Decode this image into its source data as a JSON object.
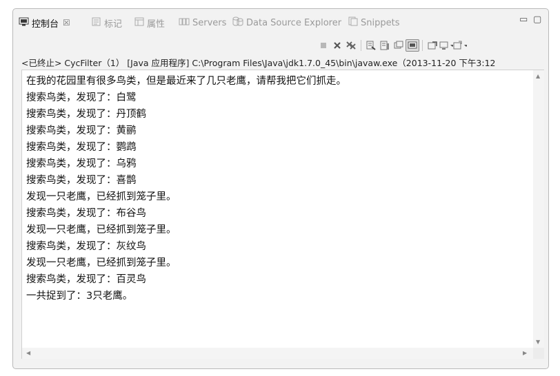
{
  "tabs": [
    {
      "label": "控制台",
      "icon": "console-icon",
      "active": true
    },
    {
      "label": "标记",
      "icon": "markers-icon"
    },
    {
      "label": "属性",
      "icon": "properties-icon"
    },
    {
      "label": "Servers",
      "icon": "servers-icon"
    },
    {
      "label": "Data Source Explorer",
      "icon": "database-icon"
    },
    {
      "label": "Snippets",
      "icon": "snippets-icon"
    }
  ],
  "active_tab_close": "☒",
  "window_controls": {
    "minimize": "▭",
    "maximize": "▢"
  },
  "toolbar_icons": [
    "stop-icon",
    "remove-launch-icon",
    "remove-all-icon",
    "clear-console-icon",
    "scroll-lock-icon",
    "word-wrap-icon",
    "pin-console-icon",
    "display-selected-console-icon",
    "open-console-icon"
  ],
  "process_description": "<已终止> CycFilter（1） [Java 应用程序] C:\\Program Files\\Java\\jdk1.7.0_45\\bin\\javaw.exe（2013-11-20 下午3:12",
  "console_lines": [
    "在我的花园里有很多鸟类，但是最近来了几只老鹰，请帮我把它们抓走。",
    "搜索鸟类，发现了：白鹭",
    "搜索鸟类，发现了：丹顶鹤",
    "搜索鸟类，发现了：黄鹂",
    "搜索鸟类，发现了：鹦鹉",
    "搜索鸟类，发现了：乌鸦",
    "搜索鸟类，发现了：喜鹊",
    "发现一只老鹰，已经抓到笼子里。",
    "搜索鸟类，发现了：布谷鸟",
    "发现一只老鹰，已经抓到笼子里。",
    "搜索鸟类，发现了：灰纹鸟",
    "发现一只老鹰，已经抓到笼子里。",
    "搜索鸟类，发现了：百灵鸟",
    "一共捉到了：3只老鹰。"
  ]
}
